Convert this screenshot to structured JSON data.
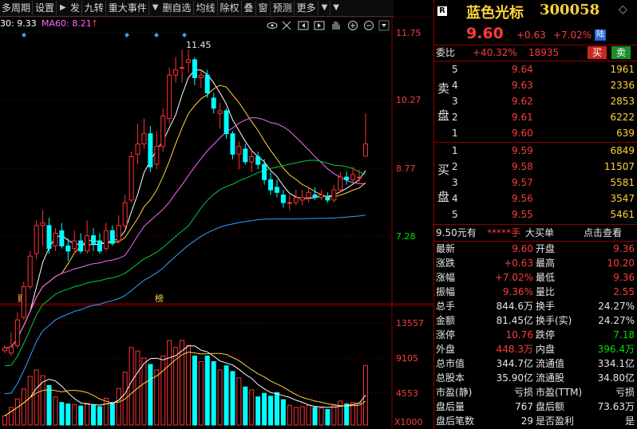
{
  "toolbar": {
    "items": [
      "多周期",
      "设置",
      "发",
      "九转",
      "重大事件",
      "删自选",
      "均线",
      "除权",
      "叠",
      "窗",
      "预测",
      "更多"
    ]
  },
  "indicator_line": {
    "ma30": "30: 9.33",
    "ma60": "MA60: 8.21",
    "up_arrow": "↑"
  },
  "tool_icons": [
    "eye-icon",
    "scissors-icon",
    "rewind-icon",
    "hand-icon",
    "zoom-in-icon",
    "zoom-out-icon",
    "dropdown-icon"
  ],
  "annotations": {
    "peak_price": "11.45",
    "marker_fin": "财",
    "marker_bang": "榜"
  },
  "price_axis": [
    "11.75",
    "10.27",
    "8.77",
    "7.28"
  ],
  "volume_axis": [
    "13557",
    "9105",
    "4553",
    "X1000"
  ],
  "header": {
    "r_badge": "R",
    "name": "蓝色光标",
    "code": "300058",
    "price": "9.60",
    "change": "+0.63",
    "pct": "+7.02%",
    "market": "陆"
  },
  "weibi": {
    "label": "委比",
    "pct": "+40.32%",
    "diff": "18935",
    "buy_btn": "买",
    "sell_btn": "卖"
  },
  "sell_orders": [
    {
      "level": "5",
      "price": "9.64",
      "vol": "1961"
    },
    {
      "level": "4",
      "price": "9.63",
      "vol": "2336"
    },
    {
      "level": "3",
      "price": "9.62",
      "vol": "2853"
    },
    {
      "level": "2",
      "price": "9.61",
      "vol": "6222"
    },
    {
      "level": "1",
      "price": "9.60",
      "vol": "639"
    }
  ],
  "buy_orders": [
    {
      "level": "1",
      "price": "9.59",
      "vol": "6849"
    },
    {
      "level": "2",
      "price": "9.58",
      "vol": "11507"
    },
    {
      "level": "3",
      "price": "9.57",
      "vol": "5581"
    },
    {
      "level": "4",
      "price": "9.56",
      "vol": "3547"
    },
    {
      "level": "5",
      "price": "9.55",
      "vol": "5461"
    }
  ],
  "sell_side_label": [
    "卖",
    "盘"
  ],
  "buy_side_label": [
    "买",
    "盘"
  ],
  "big_order": {
    "amount": "9.50元有",
    "stars": "*****手",
    "type": "大买单",
    "link": "点击查看"
  },
  "stats": [
    {
      "l1": "最新",
      "v1": "9.60",
      "c1": "red",
      "l2": "开盘",
      "v2": "9.36",
      "c2": "red"
    },
    {
      "l1": "涨跌",
      "v1": "+0.63",
      "c1": "red",
      "l2": "最高",
      "v2": "10.20",
      "c2": "red"
    },
    {
      "l1": "涨幅",
      "v1": "+7.02%",
      "c1": "red",
      "l2": "最低",
      "v2": "9.36",
      "c2": "red"
    },
    {
      "l1": "振幅",
      "v1": "9.36%",
      "c1": "red",
      "l2": "量比",
      "v2": "2.55",
      "c2": "red"
    },
    {
      "l1": "总手",
      "v1": "844.6万",
      "c1": "white",
      "l2": "换手",
      "v2": "24.27%",
      "c2": "white"
    },
    {
      "l1": "金额",
      "v1": "81.45亿",
      "c1": "white",
      "l2": "换手(实)",
      "v2": "24.27%",
      "c2": "white"
    },
    {
      "l1": "涨停",
      "v1": "10.76",
      "c1": "red",
      "l2": "跌停",
      "v2": "7.18",
      "c2": "green"
    },
    {
      "l1": "外盘",
      "v1": "448.3万",
      "c1": "red",
      "l2": "内盘",
      "v2": "396.4万",
      "c2": "green"
    },
    {
      "l1": "总市值",
      "v1": "344.7亿",
      "c1": "white",
      "l2": "流通值",
      "v2": "334.1亿",
      "c2": "white"
    },
    {
      "l1": "总股本",
      "v1": "35.90亿",
      "c1": "white",
      "l2": "流通股",
      "v2": "34.80亿",
      "c2": "white"
    },
    {
      "l1": "市盈(静)",
      "v1": "亏损",
      "c1": "white",
      "l2": "市盈(TTM)",
      "v2": "亏损",
      "c2": "white"
    },
    {
      "l1": "盘后量",
      "v1": "767",
      "c1": "white",
      "l2": "盘后额",
      "v2": "73.63万",
      "c2": "white"
    },
    {
      "l1": "盘后笔数",
      "v1": "29",
      "c1": "white",
      "l2": "是否盈利",
      "v2": "是",
      "c2": "white"
    }
  ],
  "chart_data": {
    "type": "candlestick",
    "price_range": [
      6.7,
      12.0
    ],
    "volume_range": [
      0,
      15500
    ],
    "candles": [
      {
        "o": 5.55,
        "c": 5.6,
        "h": 5.65,
        "l": 5.5,
        "v": 1300
      },
      {
        "o": 5.5,
        "c": 5.62,
        "h": 5.9,
        "l": 5.45,
        "v": 2500
      },
      {
        "o": 5.65,
        "c": 6.15,
        "h": 6.3,
        "l": 5.6,
        "v": 3700
      },
      {
        "o": 6.2,
        "c": 6.8,
        "h": 6.9,
        "l": 6.15,
        "v": 5100
      },
      {
        "o": 6.8,
        "c": 7.4,
        "h": 7.5,
        "l": 6.75,
        "v": 6900
      },
      {
        "o": 7.45,
        "c": 8.0,
        "h": 8.1,
        "l": 7.35,
        "v": 7800
      },
      {
        "o": 8.0,
        "c": 8.05,
        "h": 8.3,
        "l": 7.6,
        "v": 7000
      },
      {
        "o": 8.0,
        "c": 7.55,
        "h": 8.15,
        "l": 7.45,
        "v": 5600
      },
      {
        "o": 7.6,
        "c": 7.85,
        "h": 7.95,
        "l": 7.5,
        "v": 4000
      },
      {
        "o": 7.9,
        "c": 7.6,
        "h": 8.05,
        "l": 7.55,
        "v": 3200
      },
      {
        "o": 7.6,
        "c": 7.5,
        "h": 7.75,
        "l": 7.3,
        "v": 3000
      },
      {
        "o": 7.55,
        "c": 7.7,
        "h": 7.9,
        "l": 7.45,
        "v": 2900
      },
      {
        "o": 7.7,
        "c": 7.5,
        "h": 7.85,
        "l": 7.45,
        "v": 2700
      },
      {
        "o": 7.5,
        "c": 7.8,
        "h": 8.1,
        "l": 7.45,
        "v": 3100
      },
      {
        "o": 7.8,
        "c": 7.65,
        "h": 7.95,
        "l": 7.5,
        "v": 2800
      },
      {
        "o": 7.7,
        "c": 7.5,
        "h": 7.85,
        "l": 7.45,
        "v": 2600
      },
      {
        "o": 7.55,
        "c": 7.9,
        "h": 8.05,
        "l": 7.5,
        "v": 3800
      },
      {
        "o": 7.9,
        "c": 7.65,
        "h": 8.0,
        "l": 7.6,
        "v": 3200
      },
      {
        "o": 7.7,
        "c": 8.0,
        "h": 8.2,
        "l": 7.65,
        "v": 5200
      },
      {
        "o": 8.0,
        "c": 8.45,
        "h": 8.6,
        "l": 7.95,
        "v": 7500
      },
      {
        "o": 8.5,
        "c": 9.35,
        "h": 9.45,
        "l": 8.45,
        "v": 11000
      },
      {
        "o": 9.4,
        "c": 9.6,
        "h": 10.0,
        "l": 9.2,
        "v": 10500
      },
      {
        "o": 9.6,
        "c": 9.8,
        "h": 10.1,
        "l": 9.5,
        "v": 9500
      },
      {
        "o": 9.8,
        "c": 9.15,
        "h": 9.95,
        "l": 9.05,
        "v": 8600
      },
      {
        "o": 9.2,
        "c": 9.55,
        "h": 9.85,
        "l": 9.1,
        "v": 7800
      },
      {
        "o": 9.55,
        "c": 10.15,
        "h": 10.3,
        "l": 9.45,
        "v": 9800
      },
      {
        "o": 10.1,
        "c": 10.95,
        "h": 11.1,
        "l": 10.0,
        "v": 12000
      },
      {
        "o": 10.95,
        "c": 11.05,
        "h": 11.3,
        "l": 10.8,
        "v": 11000
      },
      {
        "o": 11.1,
        "c": 11.1,
        "h": 11.45,
        "l": 10.8,
        "v": 12000
      },
      {
        "o": 11.2,
        "c": 11.25,
        "h": 11.45,
        "l": 11.0,
        "v": 11300
      },
      {
        "o": 11.25,
        "c": 10.9,
        "h": 11.3,
        "l": 10.75,
        "v": 9800
      },
      {
        "o": 10.9,
        "c": 10.95,
        "h": 11.05,
        "l": 10.7,
        "v": 9000
      },
      {
        "o": 10.95,
        "c": 10.6,
        "h": 11.05,
        "l": 10.5,
        "v": 9800
      },
      {
        "o": 10.5,
        "c": 10.3,
        "h": 10.6,
        "l": 10.2,
        "v": 9000
      },
      {
        "o": 10.2,
        "c": 10.25,
        "h": 10.4,
        "l": 9.9,
        "v": 7800
      },
      {
        "o": 10.25,
        "c": 9.8,
        "h": 10.3,
        "l": 9.7,
        "v": 8400
      },
      {
        "o": 9.8,
        "c": 9.4,
        "h": 9.85,
        "l": 9.3,
        "v": 7600
      },
      {
        "o": 9.4,
        "c": 9.55,
        "h": 9.65,
        "l": 9.1,
        "v": 6700
      },
      {
        "o": 9.5,
        "c": 9.25,
        "h": 9.6,
        "l": 9.2,
        "v": 5400
      },
      {
        "o": 9.25,
        "c": 9.35,
        "h": 9.5,
        "l": 9.05,
        "v": 5000
      },
      {
        "o": 9.35,
        "c": 9.2,
        "h": 9.45,
        "l": 9.1,
        "v": 4000
      },
      {
        "o": 9.2,
        "c": 8.9,
        "h": 9.3,
        "l": 8.8,
        "v": 4500
      },
      {
        "o": 8.9,
        "c": 8.7,
        "h": 9.05,
        "l": 8.6,
        "v": 4100
      },
      {
        "o": 8.75,
        "c": 8.65,
        "h": 8.9,
        "l": 8.55,
        "v": 4600
      },
      {
        "o": 8.6,
        "c": 8.45,
        "h": 8.7,
        "l": 8.35,
        "v": 3600
      },
      {
        "o": 8.45,
        "c": 8.45,
        "h": 8.6,
        "l": 8.3,
        "v": 2800
      },
      {
        "o": 8.45,
        "c": 8.55,
        "h": 8.7,
        "l": 8.4,
        "v": 2500
      },
      {
        "o": 8.5,
        "c": 8.55,
        "h": 8.7,
        "l": 8.4,
        "v": 2600
      },
      {
        "o": 8.55,
        "c": 8.65,
        "h": 8.75,
        "l": 8.45,
        "v": 2800
      },
      {
        "o": 8.6,
        "c": 8.55,
        "h": 8.75,
        "l": 8.5,
        "v": 2500
      },
      {
        "o": 8.55,
        "c": 8.6,
        "h": 8.7,
        "l": 8.5,
        "v": 2400
      },
      {
        "o": 8.55,
        "c": 8.5,
        "h": 8.65,
        "l": 8.45,
        "v": 2200
      },
      {
        "o": 8.5,
        "c": 8.7,
        "h": 8.8,
        "l": 8.45,
        "v": 2800
      },
      {
        "o": 8.7,
        "c": 8.95,
        "h": 9.05,
        "l": 8.65,
        "v": 3400
      },
      {
        "o": 8.95,
        "c": 8.9,
        "h": 9.05,
        "l": 8.8,
        "v": 3000
      },
      {
        "o": 8.9,
        "c": 9.0,
        "h": 9.15,
        "l": 8.85,
        "v": 3200
      },
      {
        "o": 8.95,
        "c": 8.95,
        "h": 9.1,
        "l": 8.85,
        "v": 3100
      },
      {
        "o": 9.36,
        "c": 9.6,
        "h": 10.2,
        "l": 9.36,
        "v": 8446
      }
    ],
    "ma_colors": {
      "ma5": "#ffffff",
      "ma10": "#ffd23c",
      "ma20": "#ff66ff",
      "ma30": "#00cc44",
      "ma60": "#33a0ff"
    },
    "up_color": "#ff3232",
    "down_color": "#00ffff"
  }
}
